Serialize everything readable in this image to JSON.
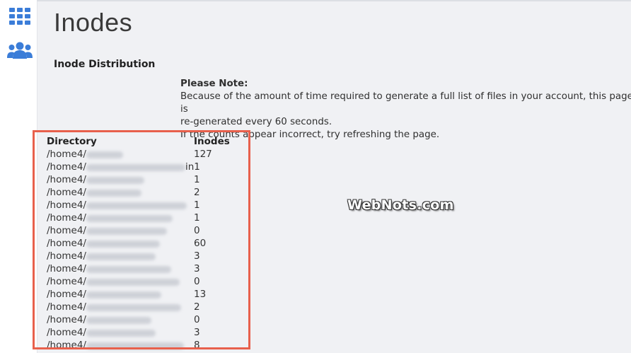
{
  "page": {
    "title": "Inodes",
    "section_title": "Inode Distribution"
  },
  "note": {
    "title": "Please Note:",
    "line1": "Because of the amount of time required to generate a full list of files in your account, this page is",
    "line2": "re-generated every 60 seconds.",
    "line3": "If the counts appear incorrect, try refreshing the page."
  },
  "sidebar": {
    "icons": [
      "grid-icon",
      "users-icon"
    ],
    "accent": "#3b7dd8"
  },
  "table": {
    "headers": {
      "directory": "Directory",
      "inodes": "Inodes"
    },
    "rows": [
      {
        "dir": "/home4/",
        "count": "127"
      },
      {
        "dir": "/home4/",
        "count": "in1"
      },
      {
        "dir": "/home4/",
        "count": "1"
      },
      {
        "dir": "/home4/",
        "count": "2"
      },
      {
        "dir": "/home4/",
        "count": "1"
      },
      {
        "dir": "/home4/",
        "count": "1"
      },
      {
        "dir": "/home4/",
        "count": "0"
      },
      {
        "dir": "/home4/",
        "count": "60"
      },
      {
        "dir": "/home4/",
        "count": "3"
      },
      {
        "dir": "/home4/",
        "count": "3"
      },
      {
        "dir": "/home4/",
        "count": "0"
      },
      {
        "dir": "/home4/",
        "count": "13"
      },
      {
        "dir": "/home4/",
        "count": "2"
      },
      {
        "dir": "/home4/",
        "count": "0"
      },
      {
        "dir": "/home4/",
        "count": "3"
      },
      {
        "dir": "/home4/",
        "count": "8"
      }
    ]
  },
  "highlight_color": "#e8604c",
  "watermark": "WebNots.com"
}
